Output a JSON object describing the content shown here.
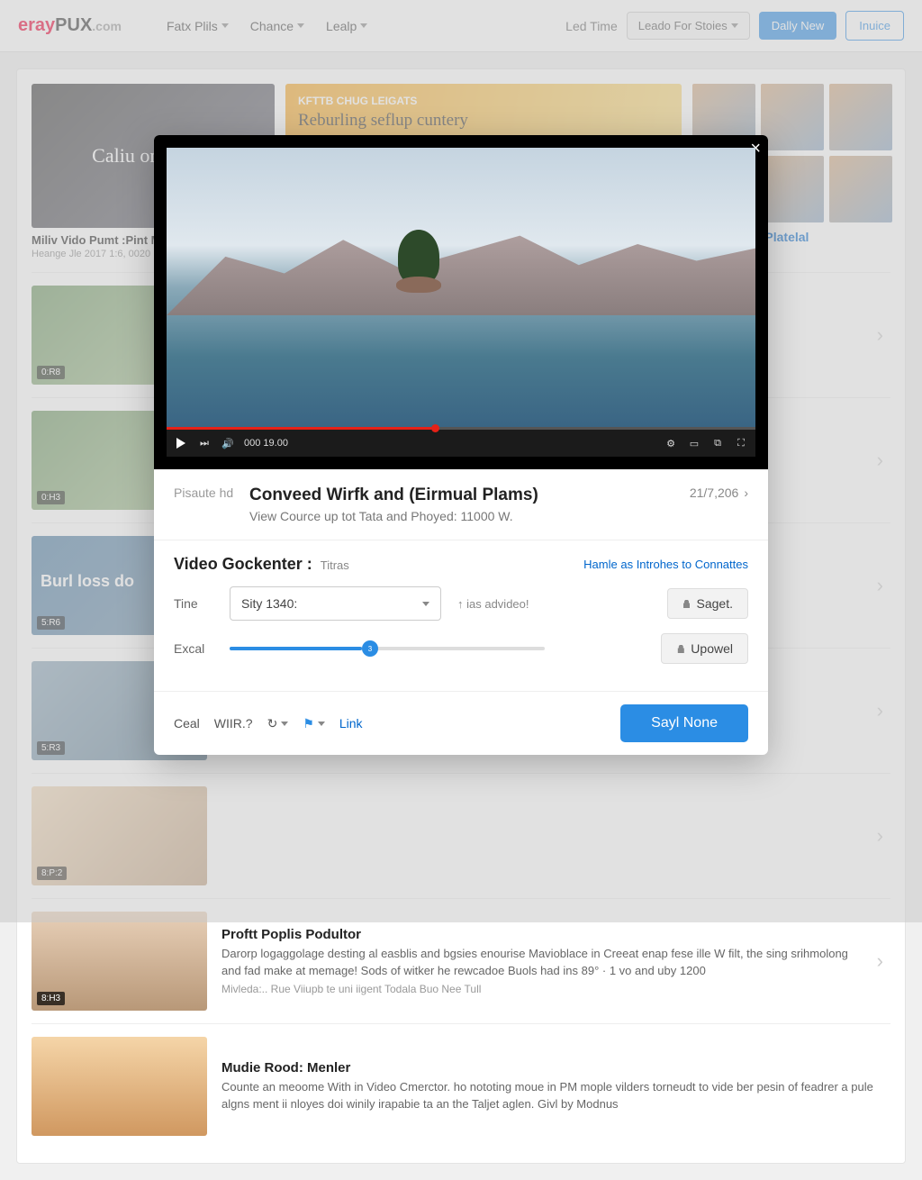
{
  "header": {
    "logo_a": "eray",
    "logo_b": "PUX",
    "logo_c": ".com",
    "nav": [
      {
        "label": "Fatx Plils"
      },
      {
        "label": "Chance"
      },
      {
        "label": "Lealp"
      }
    ],
    "led_time": "Led Time",
    "sources_btn": "Leado For Stoies",
    "daily_btn": "Dally New",
    "inuice_btn": "Inuice"
  },
  "hero": {
    "thumb1_text": "Caliu on Rahea",
    "thumb2_top": "KFTTB CHUG LEIGATS",
    "thumb2_main": "Reburling seflup cuntery",
    "caption1": "Miliv Vido Pumt :Pint Maoling Buliotes",
    "caption1_sub": "Heange Jle 2017 1:6, 0020",
    "caption_link": "iree Warrde Platelal"
  },
  "list": [
    {
      "badge": "0:R8"
    },
    {
      "badge": "0:H3"
    },
    {
      "badge": "5:R6",
      "overlay": "Burl loss do"
    },
    {
      "badge": "5:R3"
    },
    {
      "badge": "8:P:2"
    },
    {
      "badge": "8:H3",
      "title": "Proftt Poplis Podultor",
      "desc": "Darorp logaggolage desting al easblis and bgsies enourise Mavioblace in Creeat enap fese ille W filt, the sing srihmolong and fad make at memage! Sods of witker he rewcadoe Buols had ins 89° · 1 vo and uby 1200",
      "meta": "Mivleda:.. Rue Viiupb te uni iigent Todala Buo Nee Tull"
    },
    {
      "title": "Mudie Rood: Menler",
      "desc": "Counte an meoome With in Video Cmerctor. ho nototing moue in PM mople vilders torneudt to vide ber pesin of feadrer a pule algns ment ii nloyes doi winily irapabie ta an the Taljet aglen. Givl by Modnus"
    }
  ],
  "modal": {
    "time_readout": "000 19.00",
    "side_label": "Pisaute hd",
    "title": "Conveed Wirfk and (Eirmual Plams)",
    "subtitle": "View Cource up tot Tata and Phoyed: 11000 W.",
    "count": "21/7,206",
    "section_title": "Video Gockenter :",
    "section_sub": "Titras",
    "section_link": "Hamle as Introhes to Connattes",
    "form": {
      "time_label": "Tine",
      "dropdown_value": "Sity 1340:",
      "time_hint": "↑ ias advideo!",
      "save_btn": "Saget.",
      "excal_label": "Excal",
      "slider_value": "3",
      "upload_btn": "Upowel"
    },
    "footer": {
      "ceal": "Ceal",
      "wiir": "WIIR.?",
      "link": "Link",
      "primary": "Sayl None"
    }
  }
}
